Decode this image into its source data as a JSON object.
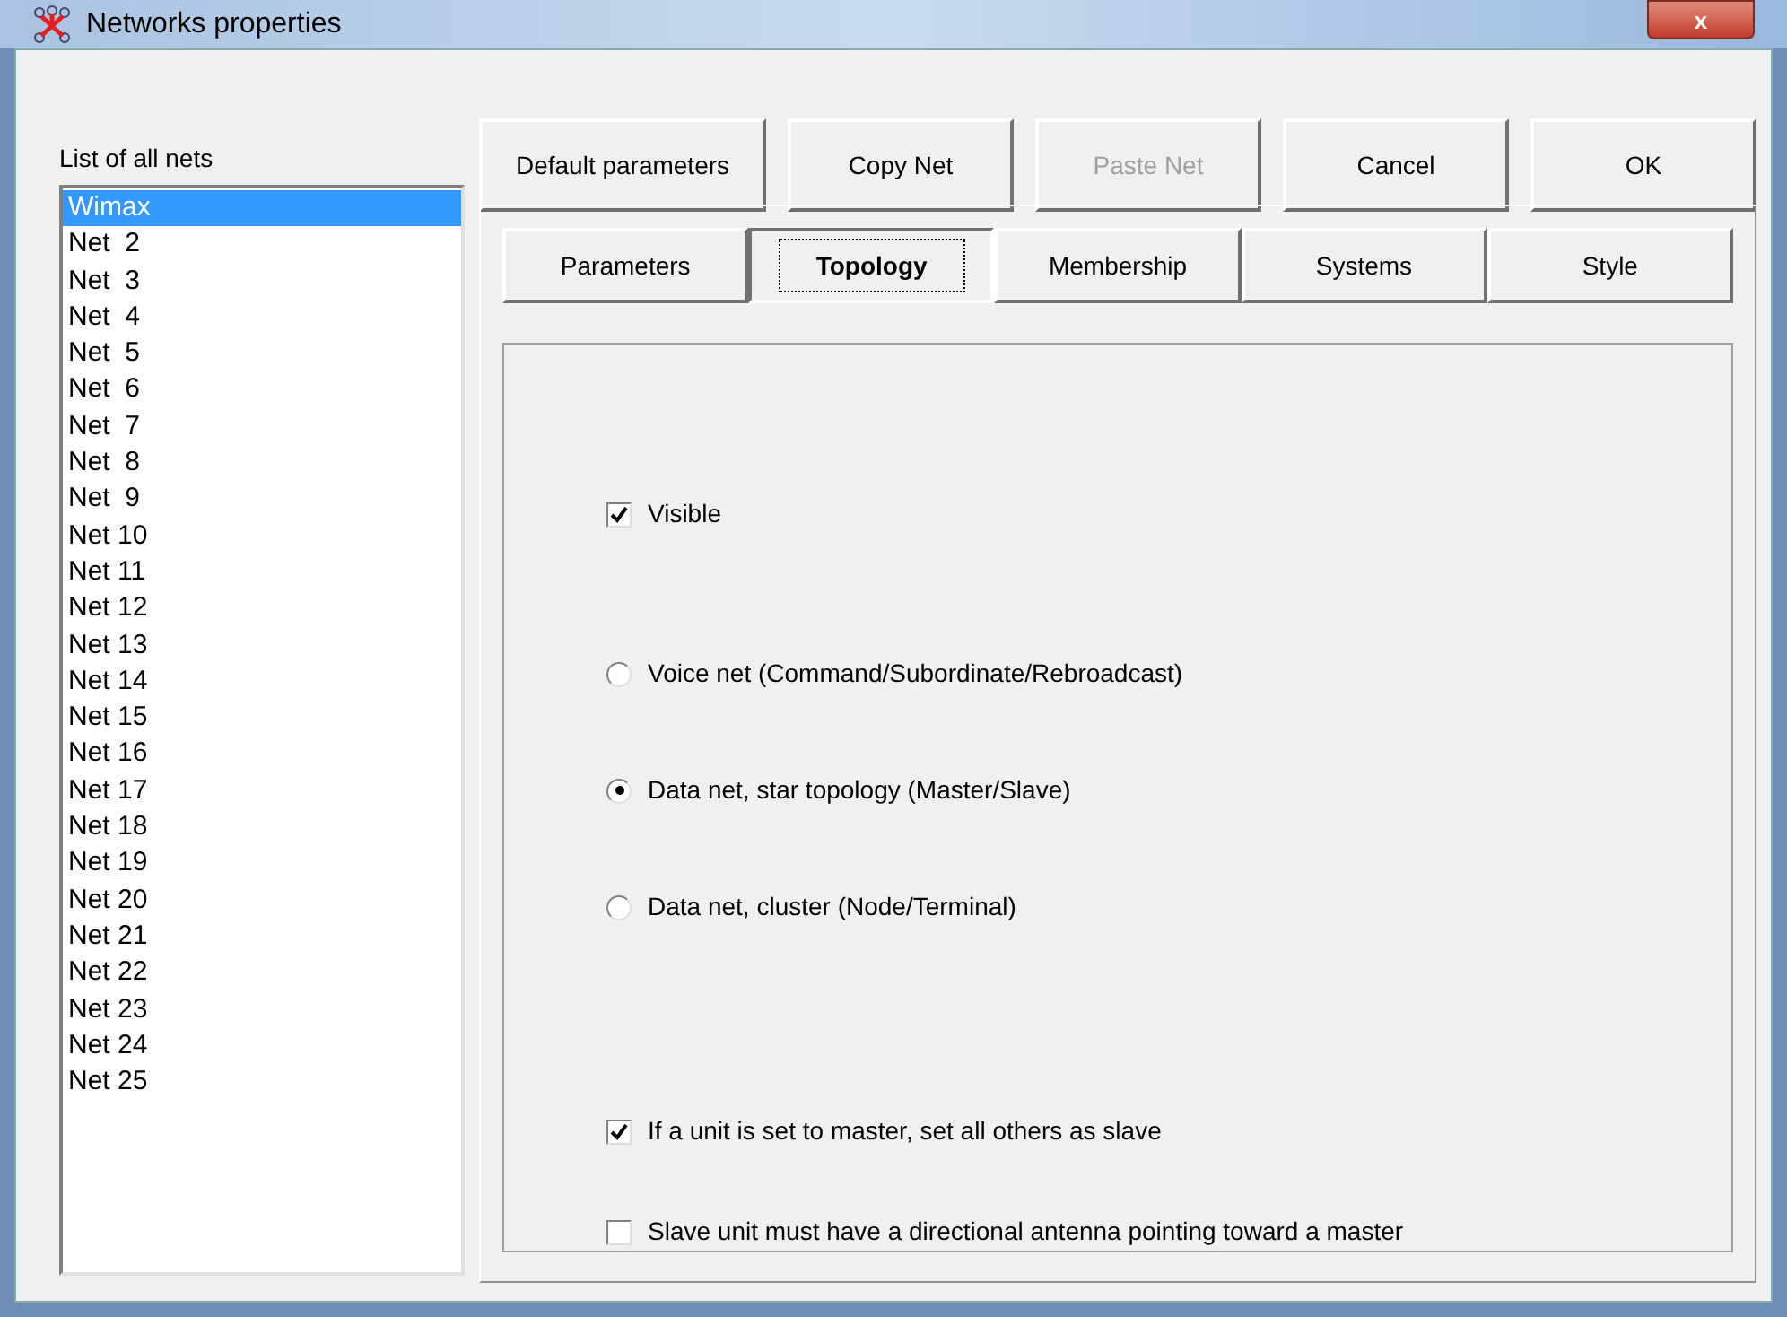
{
  "window": {
    "title": "Networks properties",
    "close": "x"
  },
  "nets": {
    "label": "List of all nets",
    "items": [
      {
        "label": "Wimax",
        "selected": true
      },
      {
        "label": "Net  2",
        "selected": false
      },
      {
        "label": "Net  3",
        "selected": false
      },
      {
        "label": "Net  4",
        "selected": false
      },
      {
        "label": "Net  5",
        "selected": false
      },
      {
        "label": "Net  6",
        "selected": false
      },
      {
        "label": "Net  7",
        "selected": false
      },
      {
        "label": "Net  8",
        "selected": false
      },
      {
        "label": "Net  9",
        "selected": false
      },
      {
        "label": "Net 10",
        "selected": false
      },
      {
        "label": "Net 11",
        "selected": false
      },
      {
        "label": "Net 12",
        "selected": false
      },
      {
        "label": "Net 13",
        "selected": false
      },
      {
        "label": "Net 14",
        "selected": false
      },
      {
        "label": "Net 15",
        "selected": false
      },
      {
        "label": "Net 16",
        "selected": false
      },
      {
        "label": "Net 17",
        "selected": false
      },
      {
        "label": "Net 18",
        "selected": false
      },
      {
        "label": "Net 19",
        "selected": false
      },
      {
        "label": "Net 20",
        "selected": false
      },
      {
        "label": "Net 21",
        "selected": false
      },
      {
        "label": "Net 22",
        "selected": false
      },
      {
        "label": "Net 23",
        "selected": false
      },
      {
        "label": "Net 24",
        "selected": false
      },
      {
        "label": "Net 25",
        "selected": false
      }
    ]
  },
  "buttons": [
    {
      "label": "Default parameters",
      "disabled": false
    },
    {
      "label": "Copy Net",
      "disabled": false
    },
    {
      "label": "Paste Net",
      "disabled": true
    },
    {
      "label": "Cancel",
      "disabled": false
    },
    {
      "label": "OK",
      "disabled": false
    }
  ],
  "tabs": [
    {
      "label": "Parameters",
      "selected": false
    },
    {
      "label": "Topology",
      "selected": true
    },
    {
      "label": "Membership",
      "selected": false
    },
    {
      "label": "Systems",
      "selected": false
    },
    {
      "label": "Style",
      "selected": false
    }
  ],
  "visible": {
    "label": "Visible",
    "checked": true
  },
  "net_type": [
    {
      "label": "Voice net (Command/Subordinate/Rebroadcast)",
      "selected": false
    },
    {
      "label": "Data net, star topology (Master/Slave)",
      "selected": true
    },
    {
      "label": "Data net, cluster (Node/Terminal)",
      "selected": false
    }
  ],
  "options": [
    {
      "label": "If a unit is set to master, set all others as slave",
      "checked": true
    },
    {
      "label": "Slave unit must have a directional antenna pointing toward a master",
      "checked": false
    }
  ]
}
